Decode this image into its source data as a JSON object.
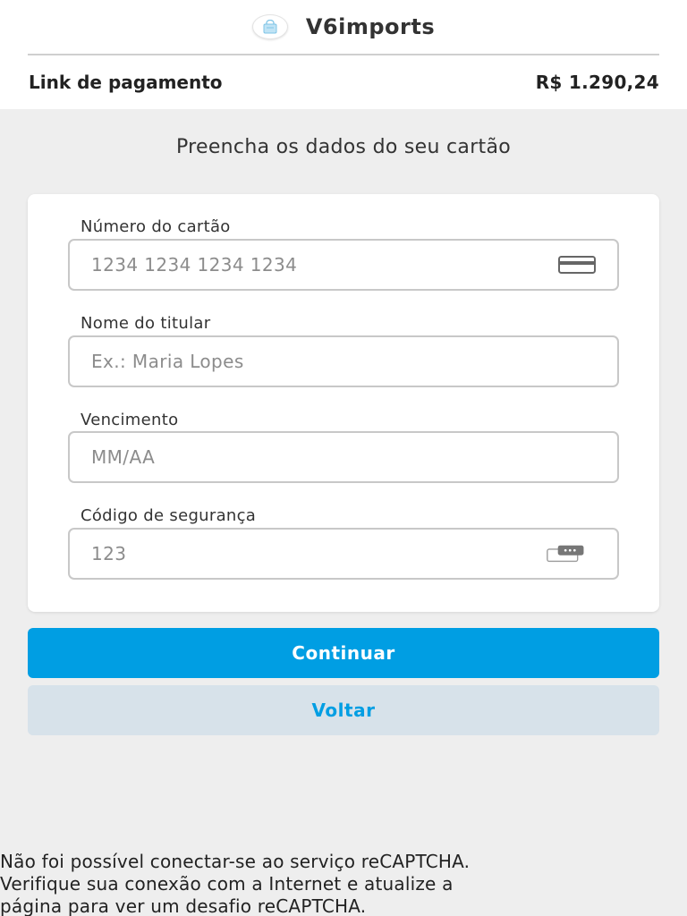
{
  "header": {
    "brand_name": "V6imports",
    "logo_icon": "shopping-bag-icon",
    "payment_label": "Link de pagamento",
    "payment_amount": "R$ 1.290,24"
  },
  "form": {
    "title": "Preencha os dados do seu cartão",
    "card_number": {
      "label": "Número do cartão",
      "value": "",
      "placeholder": "1234 1234 1234 1234",
      "icon": "credit-card-icon"
    },
    "holder_name": {
      "label": "Nome do titular",
      "value": "",
      "placeholder": "Ex.: Maria Lopes"
    },
    "expiry": {
      "label": "Vencimento",
      "value": "",
      "placeholder": "MM/AA"
    },
    "security_code": {
      "label": "Código de segurança",
      "value": "",
      "placeholder": "123",
      "icon": "card-cvv-icon"
    }
  },
  "actions": {
    "continue_label": "Continuar",
    "back_label": "Voltar"
  },
  "recaptcha": {
    "error_message": "Não foi possível conectar-se ao serviço reCAPTCHA.\nVerifique sua conexão com a Internet e atualize a\npágina para ver um desafio reCAPTCHA."
  },
  "colors": {
    "accent": "#009ee3",
    "secondary_button_bg": "#d7e2ea",
    "page_bg": "#eeeeee"
  }
}
